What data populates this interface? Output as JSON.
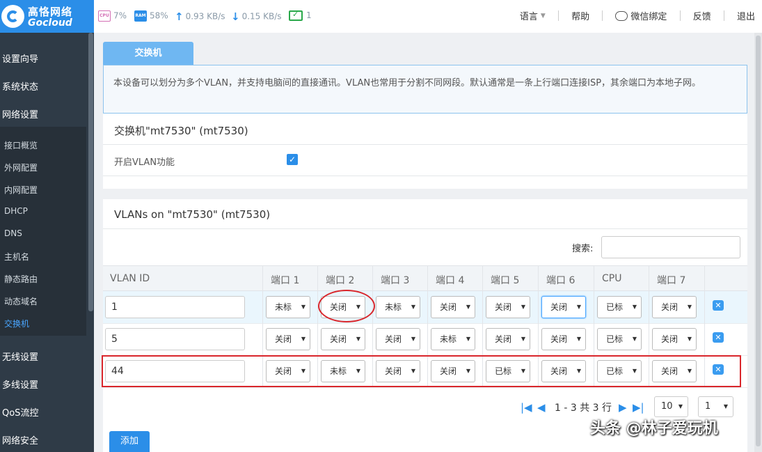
{
  "header": {
    "logo_cn": "高恪网络",
    "logo_en": "Gocloud",
    "cpu": "7%",
    "ram": "58%",
    "upload": "0.93 KB/s",
    "download": "0.15 KB/s",
    "devices": "1",
    "nav": {
      "language": "语言",
      "help": "帮助",
      "wechat": "微信绑定",
      "feedback": "反馈",
      "logout": "退出"
    }
  },
  "sidebar": {
    "main_top": [
      "设置向导",
      "系统状态",
      "网络设置"
    ],
    "sub": [
      "接口概览",
      "外网配置",
      "内网配置",
      "DHCP",
      "DNS",
      "主机名",
      "静态路由",
      "动态域名",
      "交换机"
    ],
    "active_sub": "交换机",
    "main_bottom": [
      "无线设置",
      "多线设置",
      "QoS流控",
      "网络安全"
    ]
  },
  "tab": {
    "label": "交换机"
  },
  "info_text": "本设备可以划分为多个VLAN，并支持电脑间的直接通讯。VLAN也常用于分割不同网段。默认通常是一条上行端口连接ISP，其余端口为本地子网。",
  "switch_panel": {
    "title": "交换机\"mt7530\" (mt7530)",
    "vlan_enable_label": "开启VLAN功能",
    "vlan_enabled": true
  },
  "vlan_panel": {
    "title": "VLANs on \"mt7530\" (mt7530)",
    "search_label": "搜索:",
    "columns": [
      "VLAN ID",
      "端口 1",
      "端口 2",
      "端口 3",
      "端口 4",
      "端口 5",
      "端口 6",
      "CPU",
      "端口 7"
    ],
    "rows": [
      {
        "vlan_id": "1",
        "ports": [
          "未标",
          "关闭",
          "未标",
          "关闭",
          "关闭",
          "关闭",
          "已标",
          "关闭"
        ]
      },
      {
        "vlan_id": "5",
        "ports": [
          "关闭",
          "关闭",
          "关闭",
          "未标",
          "关闭",
          "关闭",
          "已标",
          "关闭"
        ]
      },
      {
        "vlan_id": "44",
        "ports": [
          "关闭",
          "未标",
          "关闭",
          "关闭",
          "已标",
          "关闭",
          "已标",
          "关闭"
        ]
      }
    ],
    "pager_text": "1 - 3 共 3 行",
    "page_size": "10",
    "page": "1",
    "add_label": "添加"
  },
  "watermark": "头条 @林子爱玩机",
  "colors": {
    "brand": "#2b8ee8",
    "sidebar": "#2f3b47",
    "annotation": "#d9262b"
  }
}
